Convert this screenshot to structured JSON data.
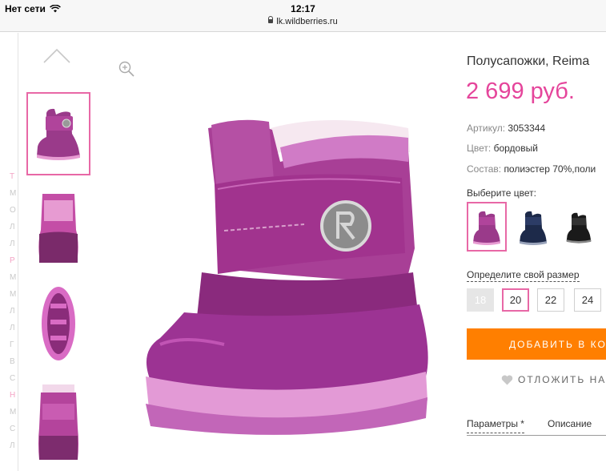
{
  "status_bar": {
    "carrier": "Нет сети",
    "time": "12:17",
    "url": "lk.wildberries.ru"
  },
  "sidebar_letters": [
    {
      "t": "Т",
      "pink": true
    },
    {
      "t": "М",
      "pink": false
    },
    {
      "t": "О",
      "pink": false
    },
    {
      "t": "Л",
      "pink": false
    },
    {
      "t": "Л",
      "pink": false
    },
    {
      "t": "Р",
      "pink": true
    },
    {
      "t": "М",
      "pink": false
    },
    {
      "t": "М",
      "pink": false
    },
    {
      "t": "Л",
      "pink": false
    },
    {
      "t": "Л",
      "pink": false
    },
    {
      "t": "Г",
      "pink": false
    },
    {
      "t": "В",
      "pink": false
    },
    {
      "t": "С",
      "pink": false
    },
    {
      "t": "Н",
      "pink": true
    },
    {
      "t": "М",
      "pink": false
    },
    {
      "t": "С",
      "pink": false
    },
    {
      "t": "Л",
      "pink": false
    }
  ],
  "gallery": {
    "thumbnails": [
      {
        "name": "thumb-front-side",
        "active": true
      },
      {
        "name": "thumb-back",
        "active": false
      },
      {
        "name": "thumb-sole",
        "active": false
      },
      {
        "name": "thumb-front",
        "active": false
      }
    ],
    "icons": {
      "up": "chevron-up-icon",
      "zoom": "zoom-in-icon"
    }
  },
  "product": {
    "title": "Полусапожки, Reima",
    "price": "2 699 руб.",
    "article_label": "Артикул:",
    "article_value": "3053344",
    "color_label": "Цвет:",
    "color_value": "бордовый",
    "composition_label": "Состав:",
    "composition_value": "полиэстер 70%,поли"
  },
  "colors": {
    "title": "Выберите цвет:",
    "options": [
      {
        "name": "purple",
        "color": "#8e2a78",
        "active": true
      },
      {
        "name": "navy",
        "color": "#1d2a4a",
        "active": false
      },
      {
        "name": "black",
        "color": "#1a1a1a",
        "active": false
      }
    ]
  },
  "sizes": {
    "title": "Определите свой размер",
    "options": [
      {
        "label": "18",
        "state": "disabled"
      },
      {
        "label": "20",
        "state": "active"
      },
      {
        "label": "22",
        "state": "normal"
      },
      {
        "label": "24",
        "state": "normal"
      }
    ]
  },
  "actions": {
    "add_to_cart": "ДОБАВИТЬ В КО",
    "defer": "ОТЛОЖИТЬ НА",
    "defer_icon": "heart-icon"
  },
  "tabs": [
    {
      "label": "Параметры *",
      "active": true
    },
    {
      "label": "Описание",
      "active": false
    }
  ],
  "colors_theme": {
    "accent": "#e5459b",
    "cta": "#ff7f00",
    "border_active": "#e868a6"
  }
}
